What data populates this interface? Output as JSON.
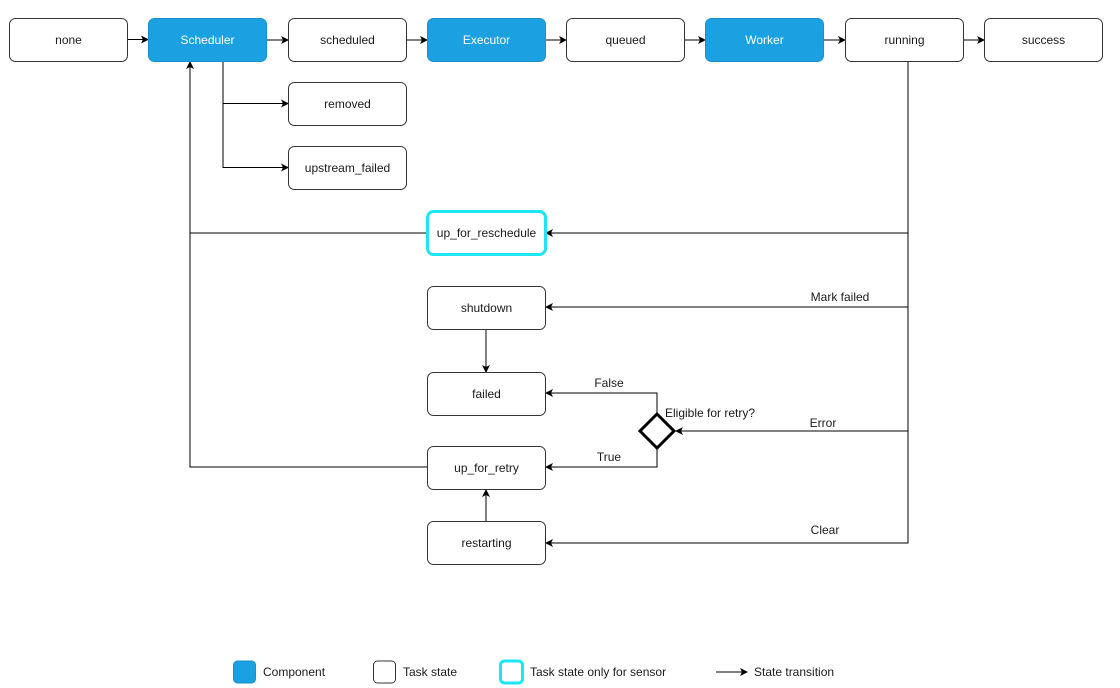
{
  "colors": {
    "component_fill": "#1ba1e2",
    "component_stroke": "#1a8fcc",
    "state_stroke": "#333333",
    "sensor_stroke": "#1ee6f0",
    "edge": "#000000"
  },
  "nodes": {
    "none": {
      "label": "none",
      "kind": "state"
    },
    "scheduler": {
      "label": "Scheduler",
      "kind": "component"
    },
    "scheduled": {
      "label": "scheduled",
      "kind": "state"
    },
    "executor": {
      "label": "Executor",
      "kind": "component"
    },
    "queued": {
      "label": "queued",
      "kind": "state"
    },
    "worker": {
      "label": "Worker",
      "kind": "component"
    },
    "running": {
      "label": "running",
      "kind": "state"
    },
    "success": {
      "label": "success",
      "kind": "state"
    },
    "removed": {
      "label": "removed",
      "kind": "state"
    },
    "upstream_failed": {
      "label": "upstream_failed",
      "kind": "state"
    },
    "up_for_reschedule": {
      "label": "up_for_reschedule",
      "kind": "sensor"
    },
    "shutdown": {
      "label": "shutdown",
      "kind": "state"
    },
    "failed": {
      "label": "failed",
      "kind": "state"
    },
    "up_for_retry": {
      "label": "up_for_retry",
      "kind": "state"
    },
    "restarting": {
      "label": "restarting",
      "kind": "state"
    }
  },
  "decision": {
    "label": "Eligible for retry?"
  },
  "edges": [
    {
      "from": "none",
      "to": "scheduler",
      "label": ""
    },
    {
      "from": "scheduler",
      "to": "scheduled",
      "label": ""
    },
    {
      "from": "scheduled",
      "to": "executor",
      "label": ""
    },
    {
      "from": "executor",
      "to": "queued",
      "label": ""
    },
    {
      "from": "queued",
      "to": "worker",
      "label": ""
    },
    {
      "from": "worker",
      "to": "running",
      "label": ""
    },
    {
      "from": "running",
      "to": "success",
      "label": ""
    },
    {
      "from": "scheduler",
      "to": "removed",
      "label": ""
    },
    {
      "from": "scheduler",
      "to": "upstream_failed",
      "label": ""
    },
    {
      "from": "running",
      "to": "up_for_reschedule",
      "label": ""
    },
    {
      "from": "up_for_reschedule",
      "to": "scheduler",
      "label": ""
    },
    {
      "from": "running",
      "to": "shutdown",
      "label": "Mark failed"
    },
    {
      "from": "shutdown",
      "to": "failed",
      "label": ""
    },
    {
      "from": "running",
      "to": "decision",
      "label": "Error"
    },
    {
      "from": "decision",
      "to": "failed",
      "label": "False"
    },
    {
      "from": "decision",
      "to": "up_for_retry",
      "label": "True"
    },
    {
      "from": "up_for_retry",
      "to": "scheduler",
      "label": ""
    },
    {
      "from": "running",
      "to": "restarting",
      "label": "Clear"
    },
    {
      "from": "restarting",
      "to": "up_for_retry",
      "label": ""
    }
  ],
  "legend": [
    {
      "kind": "component",
      "label": "Component"
    },
    {
      "kind": "state",
      "label": "Task state"
    },
    {
      "kind": "sensor",
      "label": "Task state only for sensor"
    },
    {
      "kind": "transition",
      "label": "State transition"
    }
  ]
}
